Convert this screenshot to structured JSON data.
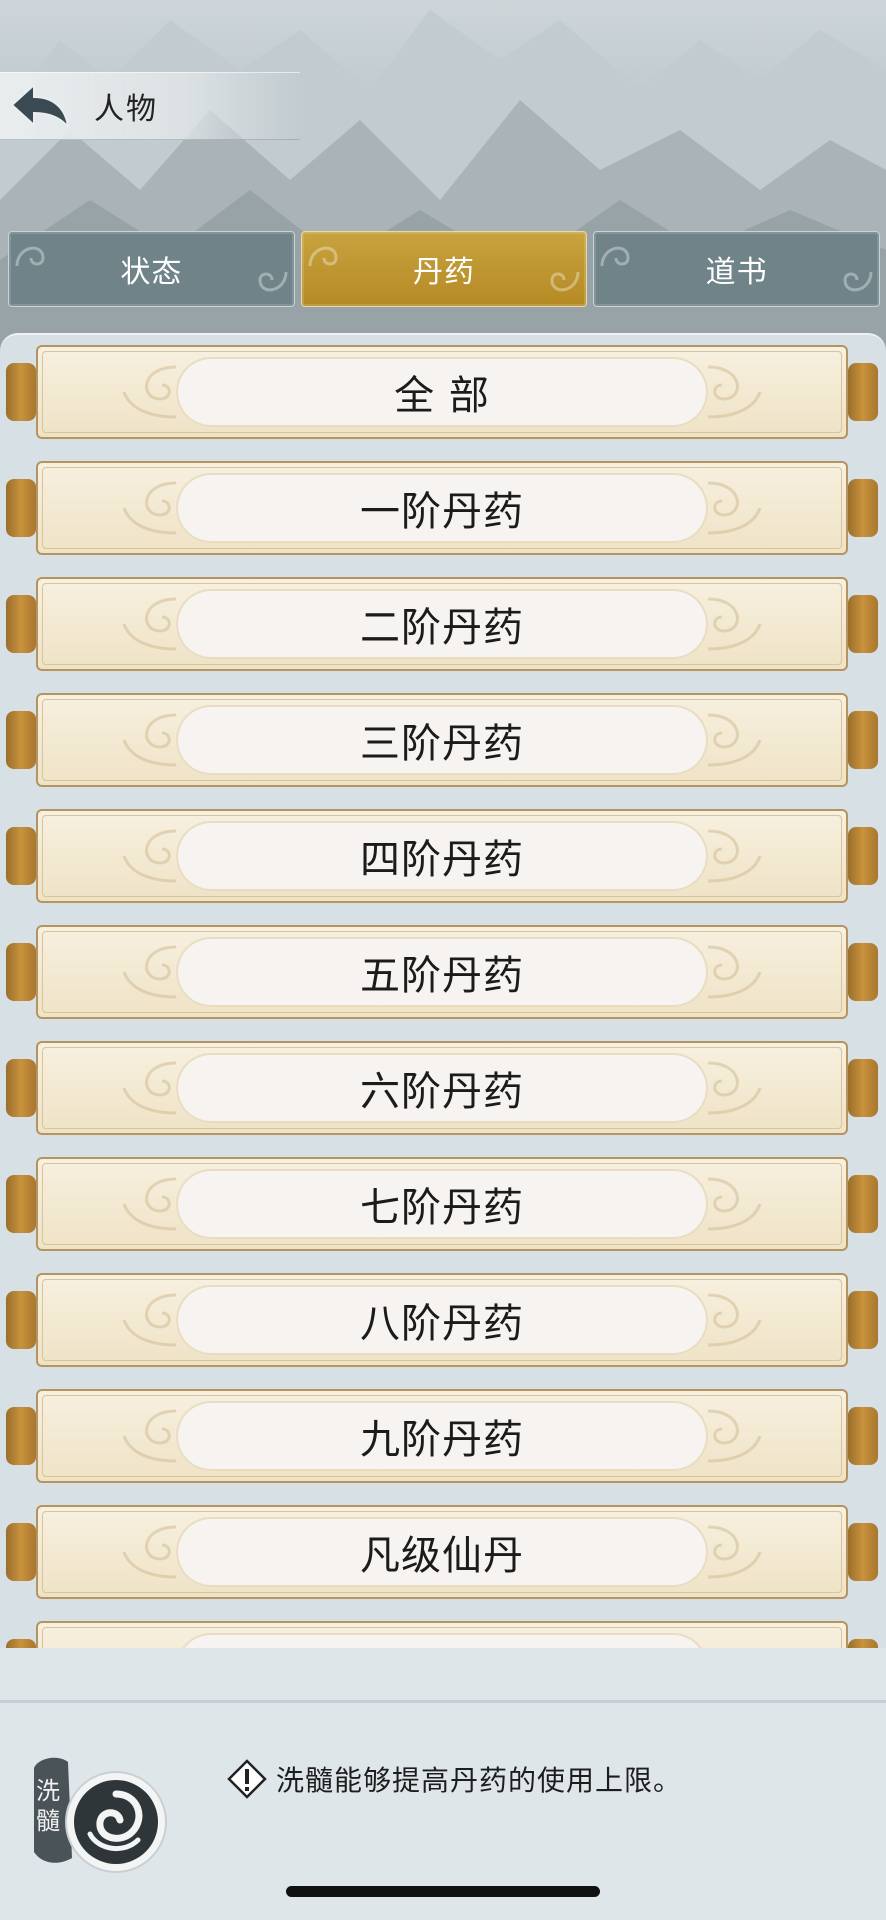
{
  "header": {
    "title": "人物"
  },
  "tabs": [
    {
      "label": "状态",
      "active": false
    },
    {
      "label": "丹药",
      "active": true
    },
    {
      "label": "道书",
      "active": false
    }
  ],
  "categories": [
    "全 部",
    "一阶丹药",
    "二阶丹药",
    "三阶丹药",
    "四阶丹药",
    "五阶丹药",
    "六阶丹药",
    "七阶丹药",
    "八阶丹药",
    "九阶丹药",
    "凡级仙丹"
  ],
  "footer": {
    "badge_text": "洗髓",
    "hint": "洗髓能够提高丹药的使用上限。"
  },
  "colors": {
    "accent": "#c8a33e",
    "tab": "#6f8389"
  }
}
